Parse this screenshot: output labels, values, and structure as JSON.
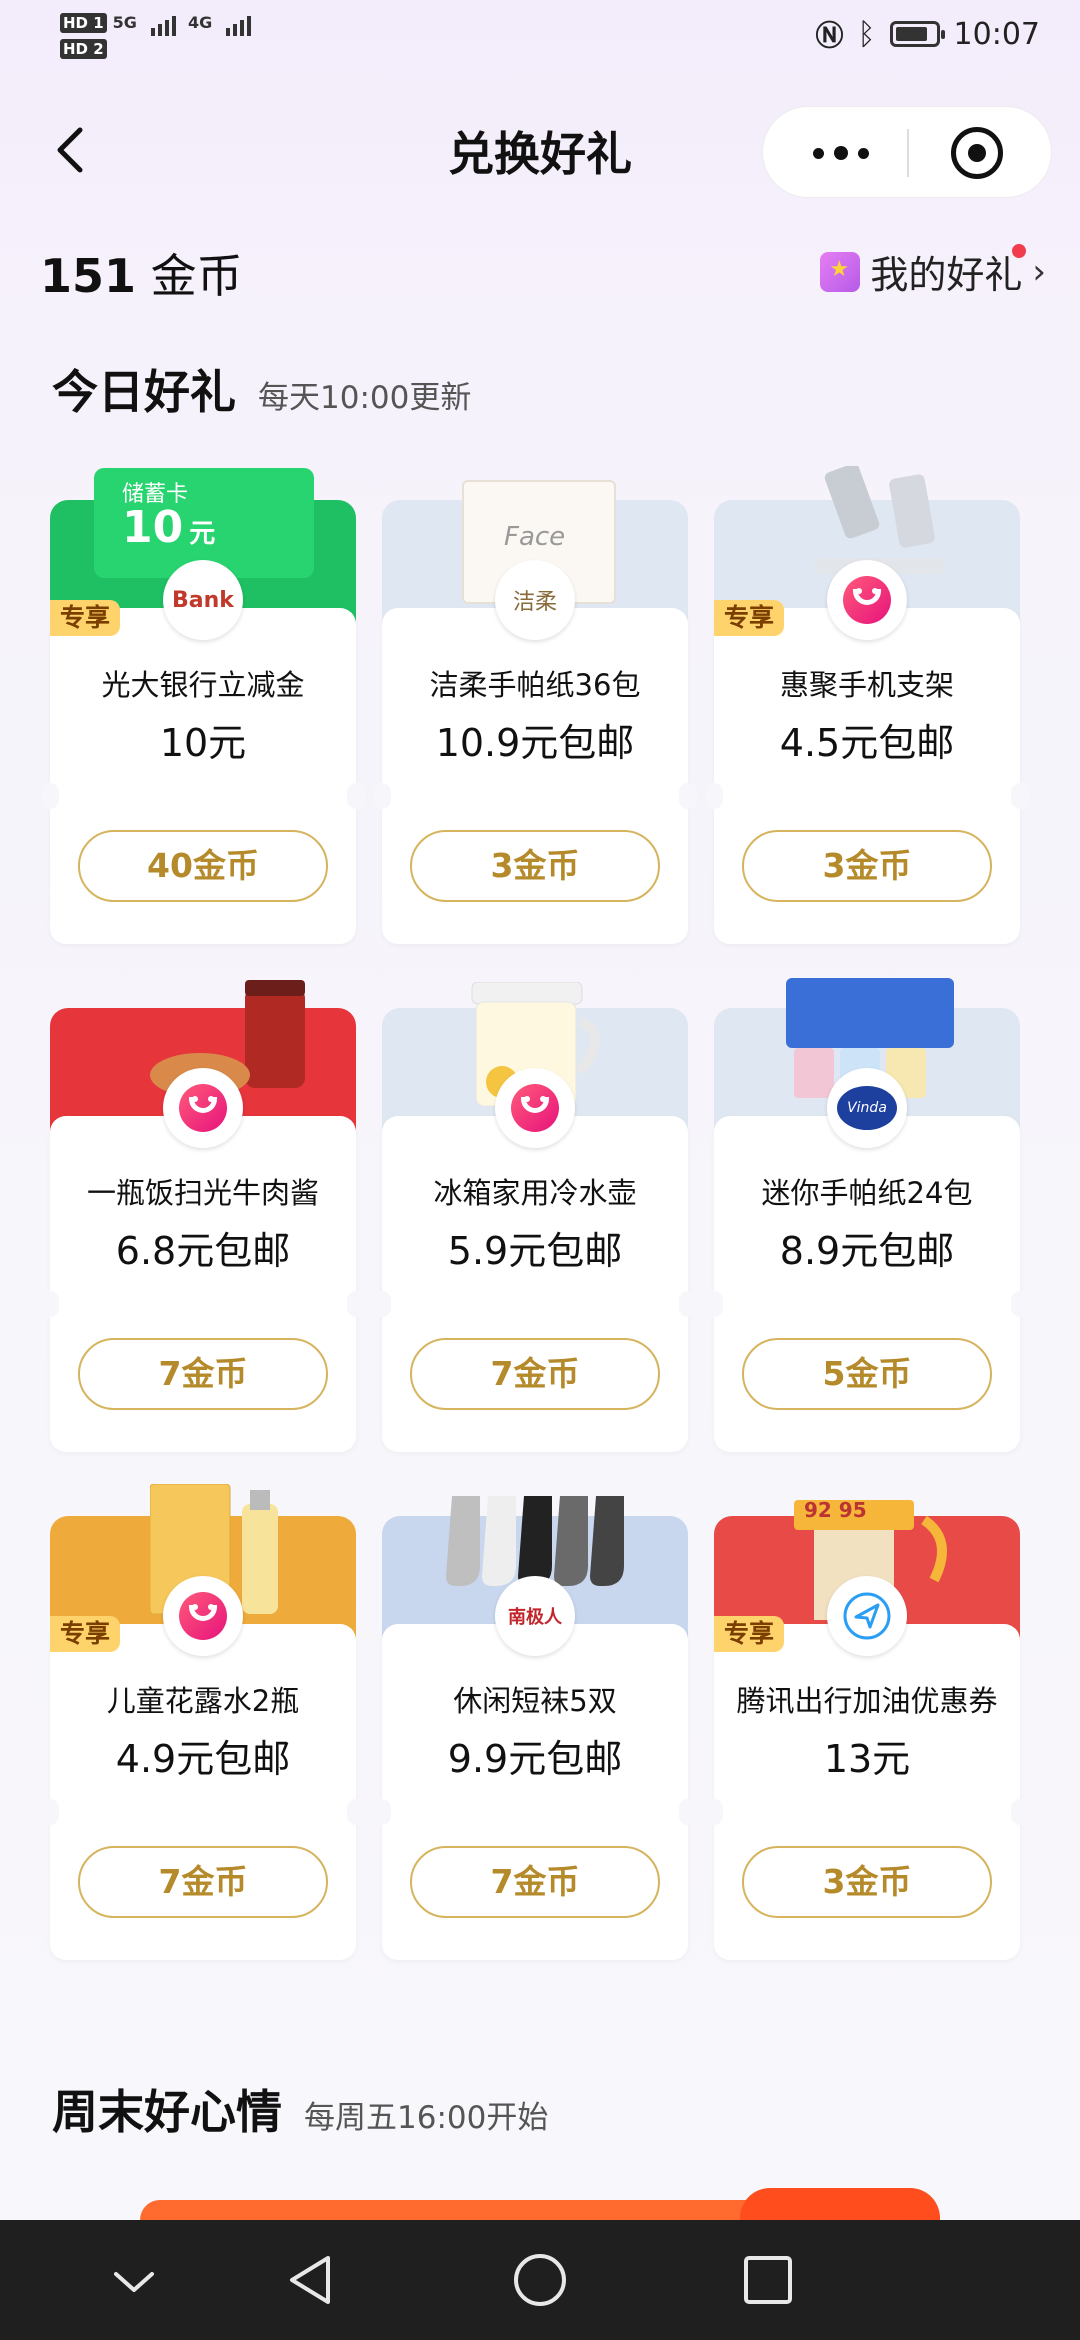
{
  "status_bar": {
    "hd1": "HD 1",
    "hd2": "HD 2",
    "net1": "5G",
    "net2": "4G",
    "time": "10:07"
  },
  "nav": {
    "title": "兑换好礼"
  },
  "account": {
    "coins": "151",
    "coins_unit": "金币",
    "my_gifts_label": "我的好礼"
  },
  "today_section": {
    "title": "今日好礼",
    "subtitle": "每天10:00更新"
  },
  "gifts": [
    {
      "name": "光大银行立减金",
      "price": "10元",
      "cost": "40金币",
      "tag": "专享",
      "banner_color": "#1fbf63",
      "banner_label": "储蓄卡",
      "banner_value": "10",
      "banner_unit": "元",
      "logo_text": "Bank"
    },
    {
      "name": "洁柔手帕纸36包",
      "price": "10.9元包邮",
      "cost": "3金币",
      "tag": "",
      "banner_color": "#dfe7f2",
      "logo_text": "洁柔"
    },
    {
      "name": "惠聚手机支架",
      "price": "4.5元包邮",
      "cost": "3金币",
      "tag": "专享",
      "banner_color": "#dfe7f2"
    },
    {
      "name": "一瓶饭扫光牛肉酱",
      "price": "6.8元包邮",
      "cost": "7金币",
      "tag": "",
      "banner_color": "#e6353b"
    },
    {
      "name": "冰箱家用冷水壶",
      "price": "5.9元包邮",
      "cost": "7金币",
      "tag": "",
      "banner_color": "#dfe7f2"
    },
    {
      "name": "迷你手帕纸24包",
      "price": "8.9元包邮",
      "cost": "5金币",
      "tag": "",
      "banner_color": "#dfe7f2",
      "logo_text": "Vinda"
    },
    {
      "name": "儿童花露水2瓶",
      "price": "4.9元包邮",
      "cost": "7金币",
      "tag": "专享",
      "banner_color": "#eeaa3a"
    },
    {
      "name": "休闲短袜5双",
      "price": "9.9元包邮",
      "cost": "7金币",
      "tag": "",
      "banner_color": "#c8d6ee",
      "logo_text": "南极人"
    },
    {
      "name": "腾讯出行加油优惠券",
      "price": "13元",
      "cost": "3金币",
      "tag": "专享",
      "banner_color": "#e84b47",
      "banner_label": "92 95"
    }
  ],
  "weekend_section": {
    "title": "周末好心情",
    "subtitle": "每周五16:00开始"
  },
  "colors": {
    "accent_gold": "#b58a2a",
    "tag_bg": "#ffd36b"
  }
}
